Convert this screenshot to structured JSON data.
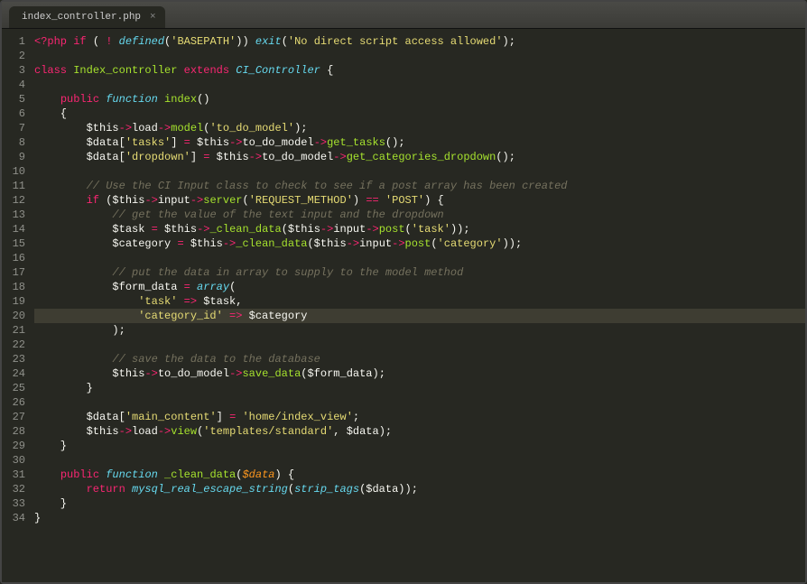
{
  "tab": {
    "filename": "index_controller.php",
    "close_glyph": "×"
  },
  "highlighted_line": 20,
  "gutter": [
    "1",
    "2",
    "3",
    "4",
    "5",
    "6",
    "7",
    "8",
    "9",
    "10",
    "11",
    "12",
    "13",
    "14",
    "15",
    "16",
    "17",
    "18",
    "19",
    "20",
    "21",
    "22",
    "23",
    "24",
    "25",
    "26",
    "27",
    "28",
    "29",
    "30",
    "31",
    "32",
    "33",
    "34"
  ],
  "code": {
    "l1": {
      "a": "<?php",
      "b": " if",
      "c": " ( ",
      "d": "!",
      "e": " defined",
      "f": "(",
      "g": "'BASEPATH'",
      "h": ")) ",
      "i": "exit",
      "j": "(",
      "k": "'No direct script access allowed'",
      "l": ");"
    },
    "l2": {
      "a": ""
    },
    "l3": {
      "a": "class ",
      "b": "Index_controller",
      "c": " extends ",
      "d": "CI_Controller",
      "e": " {"
    },
    "l4": {
      "a": ""
    },
    "l5": {
      "a": "    ",
      "b": "public ",
      "c": "function ",
      "d": "index",
      "e": "()"
    },
    "l6": {
      "a": "    {"
    },
    "l7": {
      "a": "        ",
      "b": "$this",
      "c": "->",
      "d": "load",
      "e": "->",
      "f": "model",
      "g": "(",
      "h": "'to_do_model'",
      "i": ");"
    },
    "l8": {
      "a": "        ",
      "b": "$data",
      "c": "[",
      "d": "'tasks'",
      "e": "] ",
      "f": "=",
      "g": " $this",
      "h": "->",
      "i": "to_do_model",
      "j": "->",
      "k": "get_tasks",
      "l": "();"
    },
    "l9": {
      "a": "        ",
      "b": "$data",
      "c": "[",
      "d": "'dropdown'",
      "e": "] ",
      "f": "=",
      "g": " $this",
      "h": "->",
      "i": "to_do_model",
      "j": "->",
      "k": "get_categories_dropdown",
      "l": "();"
    },
    "l10": {
      "a": ""
    },
    "l11": {
      "a": "        ",
      "b": "// Use the CI Input class to check to see if a post array has been created"
    },
    "l12": {
      "a": "        ",
      "b": "if",
      "c": " ($this",
      "d": "->",
      "e": "input",
      "f": "->",
      "g": "server",
      "h": "(",
      "i": "'REQUEST_METHOD'",
      "j": ") ",
      "k": "==",
      "l": " ",
      "m": "'POST'",
      "n": ") {"
    },
    "l13": {
      "a": "            ",
      "b": "// get the value of the text input and the dropdown"
    },
    "l14": {
      "a": "            ",
      "b": "$task",
      "c": " ",
      "d": "=",
      "e": " $this",
      "f": "->",
      "g": "_clean_data",
      "h": "($this",
      "i": "->",
      "j": "input",
      "k": "->",
      "l": "post",
      "m": "(",
      "n": "'task'",
      "o": "));"
    },
    "l15": {
      "a": "            ",
      "b": "$category",
      "c": " ",
      "d": "=",
      "e": " $this",
      "f": "->",
      "g": "_clean_data",
      "h": "($this",
      "i": "->",
      "j": "input",
      "k": "->",
      "l": "post",
      "m": "(",
      "n": "'category'",
      "o": "));"
    },
    "l16": {
      "a": ""
    },
    "l17": {
      "a": "            ",
      "b": "// put the data in array to supply to the model method"
    },
    "l18": {
      "a": "            ",
      "b": "$form_data",
      "c": " ",
      "d": "=",
      "e": " ",
      "f": "array",
      "g": "("
    },
    "l19": {
      "a": "                ",
      "b": "'task'",
      "c": " ",
      "d": "=>",
      "e": " $task,"
    },
    "l20": {
      "a": "                ",
      "b": "'category_id'",
      "c": " ",
      "d": "=>",
      "e": " $category"
    },
    "l21": {
      "a": "            );"
    },
    "l22": {
      "a": ""
    },
    "l23": {
      "a": "            ",
      "b": "// save the data to the database"
    },
    "l24": {
      "a": "            ",
      "b": "$this",
      "c": "->",
      "d": "to_do_model",
      "e": "->",
      "f": "save_data",
      "g": "($form_data);"
    },
    "l25": {
      "a": "        }"
    },
    "l26": {
      "a": ""
    },
    "l27": {
      "a": "        ",
      "b": "$data",
      "c": "[",
      "d": "'main_content'",
      "e": "] ",
      "f": "=",
      "g": " ",
      "h": "'home/index_view'",
      "i": ";"
    },
    "l28": {
      "a": "        ",
      "b": "$this",
      "c": "->",
      "d": "load",
      "e": "->",
      "f": "view",
      "g": "(",
      "h": "'templates/standard'",
      "i": ", $data);"
    },
    "l29": {
      "a": "    }"
    },
    "l30": {
      "a": ""
    },
    "l31": {
      "a": "    ",
      "b": "public ",
      "c": "function ",
      "d": "_clean_data",
      "e": "(",
      "f": "$data",
      "g": ") {"
    },
    "l32": {
      "a": "        ",
      "b": "return ",
      "c": "mysql_real_escape_string",
      "d": "(",
      "e": "strip_tags",
      "f": "($data));"
    },
    "l33": {
      "a": "    }"
    },
    "l34": {
      "a": "}"
    }
  }
}
